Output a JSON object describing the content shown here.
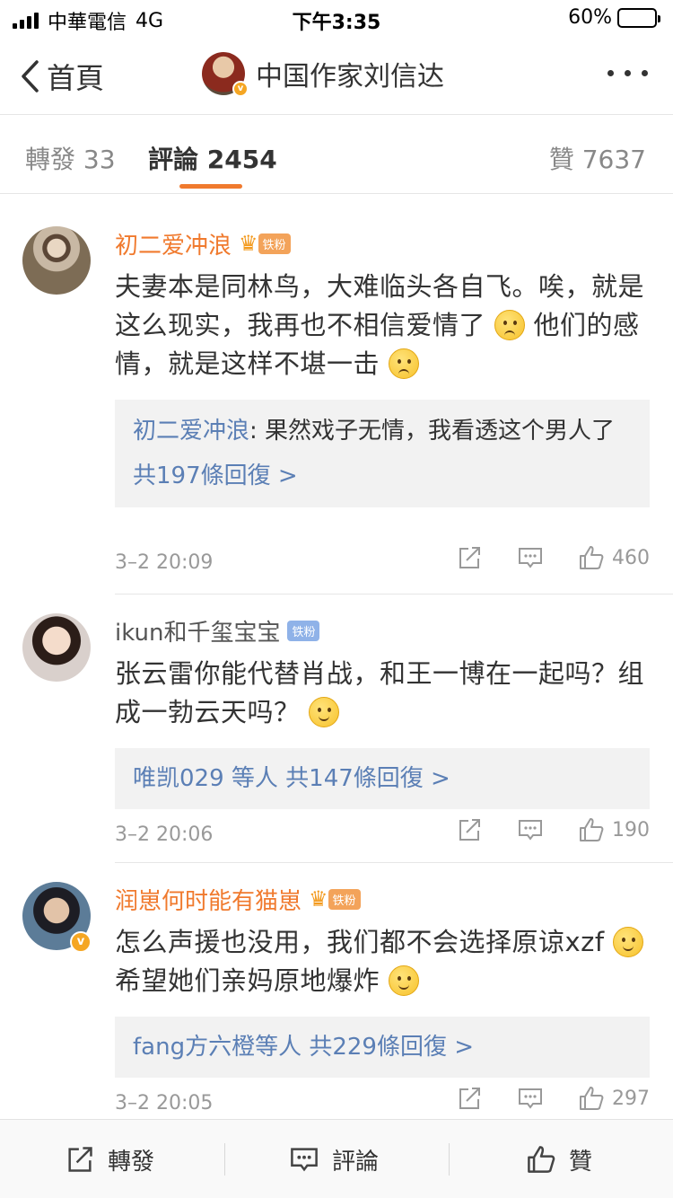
{
  "status_bar": {
    "carrier": "中華電信",
    "network": "4G",
    "time": "下午3:35",
    "battery": "60%",
    "battery_level": 0.6
  },
  "nav": {
    "back_label": "首頁",
    "title": "中国作家刘信达"
  },
  "tabs": [
    {
      "label": "轉發 33"
    },
    {
      "label": "評論 2454"
    },
    {
      "label": "贊 7637"
    }
  ],
  "comments": [
    {
      "username": "初二爱冲浪",
      "badge": "铁粉",
      "text_1": "夫妻本是同林鸟，大难临头各自飞。唉，就是这么现实，我再也不相信爱情了",
      "text_2": "他们的感情，就是这样不堪一击",
      "reply_name": "初二爱冲浪",
      "reply_text": ": 果然戏子无情，我看透这个男人了",
      "reply_more": "共197條回復 >",
      "time": "3–2 20:09",
      "likes": "460"
    },
    {
      "username": "ikun和千玺宝宝",
      "badge": "铁粉",
      "text_1": "张云雷你能代替肖战，和王一博在一起吗？组成一勃云天吗？",
      "reply_more": "唯凯029 等人 共147條回復 >",
      "time": "3–2 20:06",
      "likes": "190"
    },
    {
      "username": "润崽何时能有猫崽",
      "badge": "铁粉",
      "text_1": "怎么声援也没用，我们都不会选择原谅xzf",
      "text_2": "希望她们亲妈原地爆炸",
      "reply_more": "fang方六橙等人 共229條回復 >",
      "time": "3–2 20:05",
      "likes": "297"
    }
  ],
  "toolbar": {
    "repost": "轉發",
    "comment": "評論",
    "like": "贊"
  },
  "colors": {
    "accent": "#f07a2e",
    "link": "#5b7fb5",
    "divider": "#e6e6e6"
  }
}
